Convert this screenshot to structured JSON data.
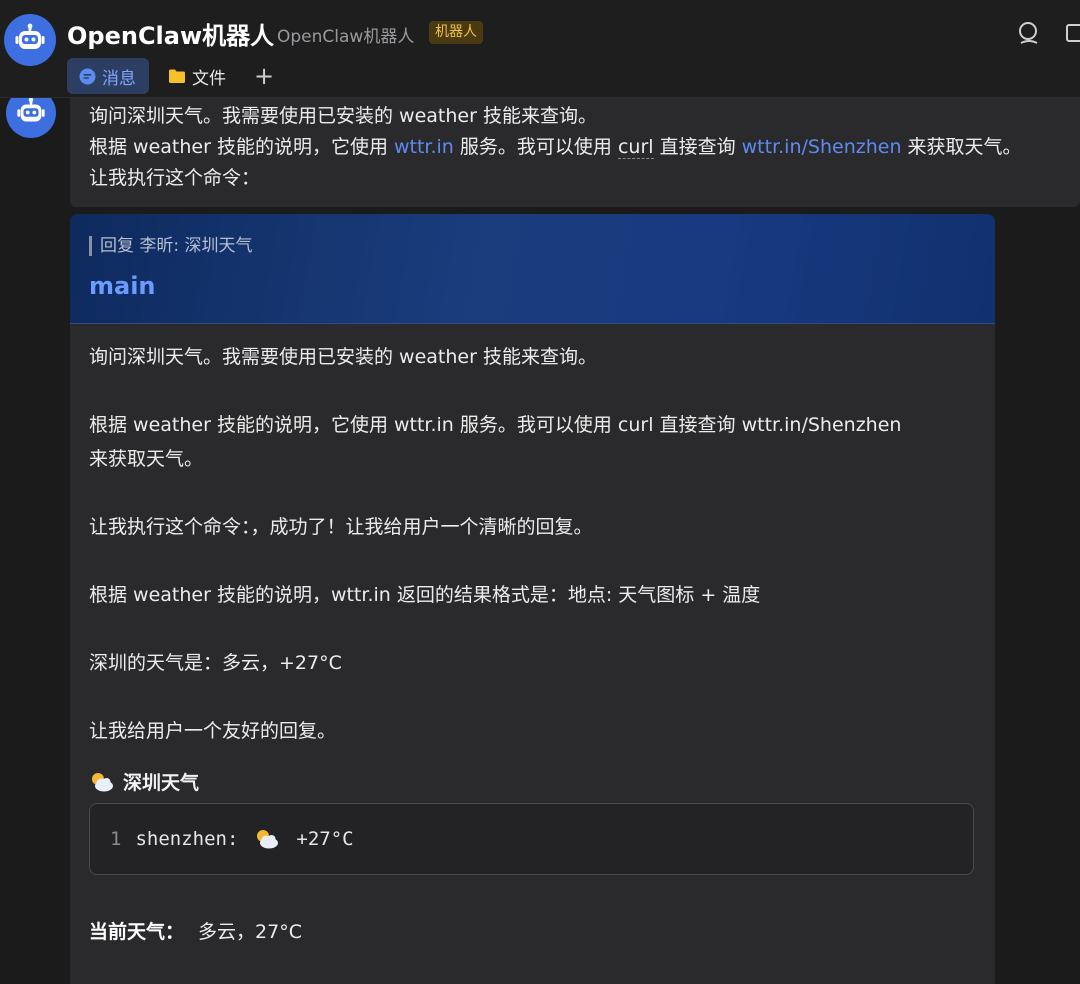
{
  "header": {
    "title": "OpenClaw机器人",
    "subtitle": "OpenClaw机器人",
    "badge": "机器人",
    "tabs": [
      {
        "label": "消息",
        "active": true
      },
      {
        "label": "文件",
        "active": false
      },
      {
        "label": "+",
        "active": false
      }
    ]
  },
  "top_message": {
    "line1": "询问深圳天气。我需要使用已安装的 weather 技能来查询。",
    "line2_a": "根据 weather 技能的说明，它使用 ",
    "line2_link1": "wttr.in",
    "line2_b": " 服务。我可以使用 ",
    "line2_curl": "curl",
    "line2_c": " 直接查询 ",
    "line2_link2": "wttr.in/Shenzhen",
    "line2_d": " 来获取天气。",
    "line3": "让我执行这个命令："
  },
  "card": {
    "reply_to": "回复 李昕: 深圳天气",
    "label": "main",
    "paragraphs": [
      "询问深圳天气。我需要使用已安装的 weather 技能来查询。",
      "根据 weather 技能的说明，它使用 wttr.in 服务。我可以使用 curl 直接查询 wttr.in/Shenzhen",
      "来获取天气。",
      "让我执行这个命令：，成功了！让我给用户一个清晰的回复。",
      "根据 weather 技能的说明，wttr.in 返回的结果格式是：地点: 天气图标 + 温度",
      "深圳的天气是：多云，+27°C",
      "让我给用户一个友好的回复。"
    ],
    "section_title": "深圳天气",
    "code": {
      "line_number": "1",
      "prefix": "shenzhen:",
      "temp": "+27°C"
    },
    "current_label": "当前天气：",
    "current_value": "多云，27°C"
  },
  "colors": {
    "accent": "#5d8bf2",
    "badge": "#f0c24a",
    "avatar": "#3d6fe0"
  }
}
